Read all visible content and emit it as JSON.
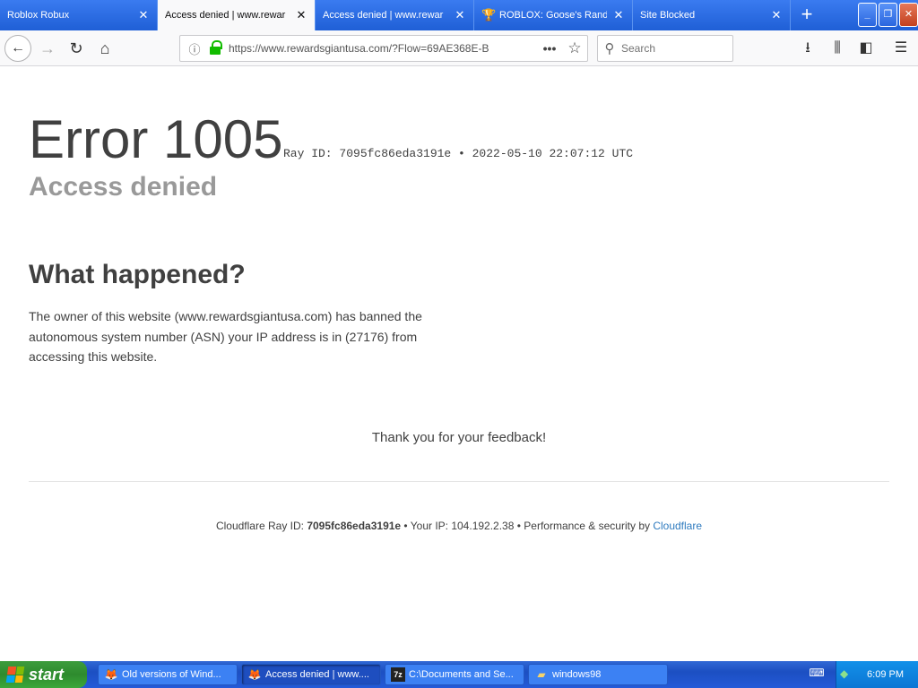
{
  "tabs": [
    {
      "label": "Roblox Robux",
      "active": false,
      "icon": ""
    },
    {
      "label": "Access denied | www.rewar",
      "active": true,
      "icon": ""
    },
    {
      "label": "Access denied | www.rewar",
      "active": false,
      "icon": ""
    },
    {
      "label": "ROBLOX: Goose's Rando",
      "active": false,
      "icon": "trophy-icon"
    },
    {
      "label": "Site Blocked",
      "active": false,
      "icon": ""
    }
  ],
  "toolbar": {
    "url": "https://www.rewardsgiantusa.com/?Flow=69AE368E-B",
    "search_placeholder": "Search"
  },
  "page": {
    "error_code": "Error 1005",
    "ray_line": "Ray ID: 7095fc86eda3191e • 2022-05-10 22:07:12 UTC",
    "subtitle": "Access denied",
    "what_heading": "What happened?",
    "explanation": "The owner of this website (www.rewardsgiantusa.com) has banned the autonomous system number (ASN) your IP address is in (27176) from accessing this website.",
    "thanks": "Thank you for your feedback!",
    "footer": {
      "ray_label": "Cloudflare Ray ID: ",
      "ray_id": "7095fc86eda3191e",
      "ip_text": " • Your IP: 104.192.2.38 • Performance & security by ",
      "cf_link": "Cloudflare"
    }
  },
  "taskbar": {
    "start_label": "start",
    "tasks": [
      {
        "label": "Old versions of Wind...",
        "icon": "firefox-icon",
        "active": false
      },
      {
        "label": "Access denied | www....",
        "icon": "firefox-icon",
        "active": true
      },
      {
        "label": "C:\\Documents and Se...",
        "icon": "7zip-icon",
        "active": false
      },
      {
        "label": "windows98",
        "icon": "folder-icon",
        "active": false
      }
    ],
    "clock": "6:09 PM"
  }
}
